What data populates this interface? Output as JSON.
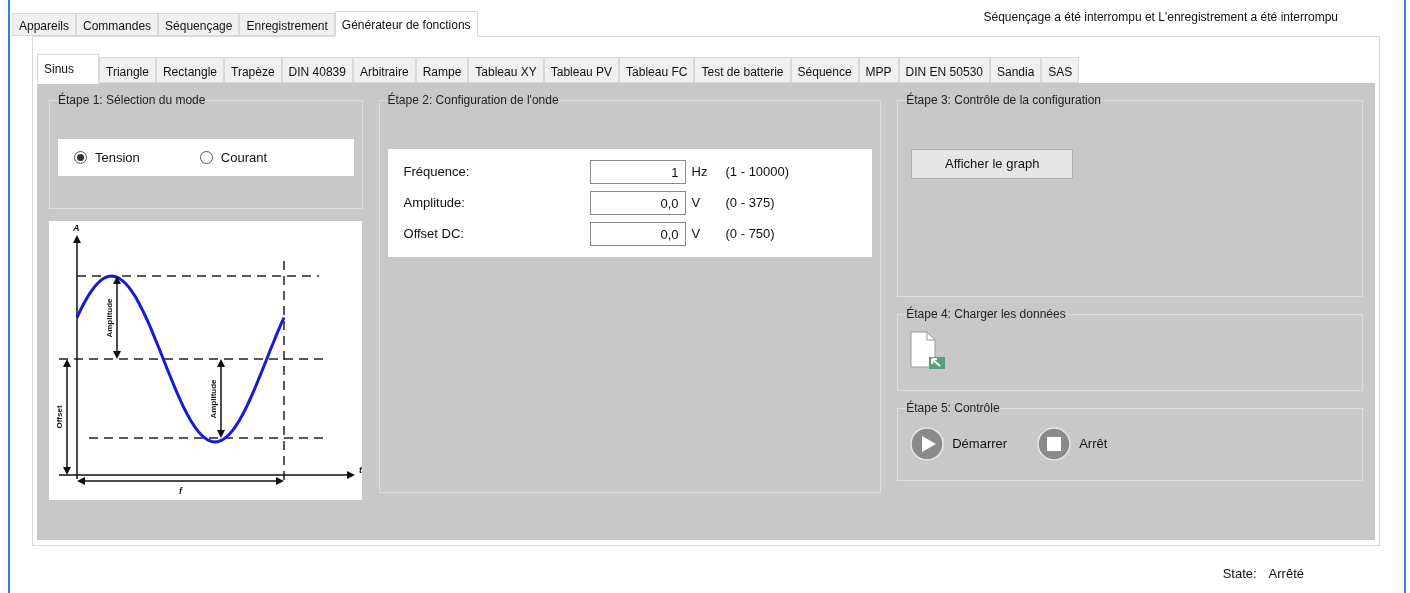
{
  "main_tabs": [
    {
      "label": "Appareils",
      "selected": false
    },
    {
      "label": "Commandes",
      "selected": false
    },
    {
      "label": "Séquençage",
      "selected": false
    },
    {
      "label": "Enregistrement",
      "selected": false
    },
    {
      "label": "Générateur de fonctions",
      "selected": true
    }
  ],
  "status_message": "Séquençage a été interrompu et L'enregistrement a été interrompu",
  "wave_tabs": [
    {
      "label": "Sinus",
      "selected": true
    },
    {
      "label": "Triangle",
      "selected": false
    },
    {
      "label": "Rectangle",
      "selected": false
    },
    {
      "label": "Trapèze",
      "selected": false
    },
    {
      "label": "DIN 40839",
      "selected": false
    },
    {
      "label": "Arbitraire",
      "selected": false
    },
    {
      "label": "Rampe",
      "selected": false
    },
    {
      "label": "Tableau XY",
      "selected": false
    },
    {
      "label": "Tableau PV",
      "selected": false
    },
    {
      "label": "Tableau FC",
      "selected": false
    },
    {
      "label": "Test de batterie",
      "selected": false
    },
    {
      "label": "Séquence",
      "selected": false
    },
    {
      "label": "MPP",
      "selected": false
    },
    {
      "label": "DIN EN 50530",
      "selected": false
    },
    {
      "label": "Sandia",
      "selected": false
    },
    {
      "label": "SAS",
      "selected": false
    }
  ],
  "step1": {
    "title": "Étape 1: Sélection du mode",
    "options": [
      {
        "label": "Tension",
        "selected": true
      },
      {
        "label": "Courant",
        "selected": false
      }
    ]
  },
  "diagram": {
    "axis_y": "A",
    "axis_x": "t",
    "amplitude_upper": "Amplitude",
    "amplitude_lower": "Amplitude",
    "offset": "Offset",
    "period": "f"
  },
  "step2": {
    "title": "Étape 2: Configuration de l'onde",
    "fields": [
      {
        "label": "Fréquence:",
        "value": "1",
        "unit": "Hz",
        "range": "(1 - 10000)"
      },
      {
        "label": "Amplitude:",
        "value": "0,0",
        "unit": "V",
        "range": "(0 - 375)"
      },
      {
        "label": "Offset DC:",
        "value": "0,0",
        "unit": "V",
        "range": "(0 - 750)"
      }
    ]
  },
  "step3": {
    "title": "Étape 3: Contrôle de la configuration",
    "button": "Afficher le graph"
  },
  "step4": {
    "title": "Étape 4: Charger les données"
  },
  "step5": {
    "title": "Étape 5: Contrôle",
    "buttons": [
      {
        "kind": "start",
        "label": "Démarrer"
      },
      {
        "kind": "stop",
        "label": "Arrêt"
      }
    ]
  },
  "status_bar": {
    "label": "State:",
    "value": "Arrêté"
  }
}
